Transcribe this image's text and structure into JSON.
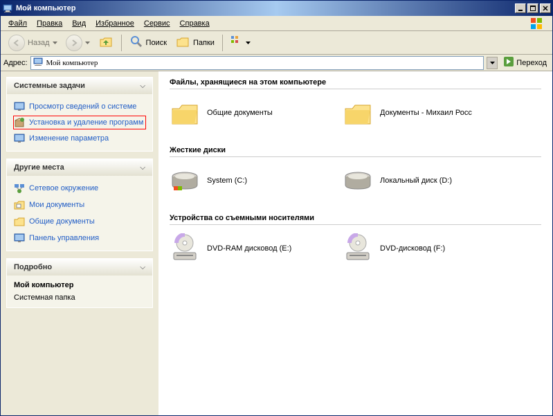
{
  "window": {
    "title": "Мой компьютер"
  },
  "menu": {
    "file": "Файл",
    "edit": "Правка",
    "view": "Вид",
    "favorites": "Избранное",
    "service": "Сервис",
    "help": "Справка"
  },
  "toolbar": {
    "back": "Назад",
    "search": "Поиск",
    "folders": "Папки"
  },
  "address": {
    "label": "Адрес:",
    "value": "Мой компьютер",
    "go": "Переход"
  },
  "panels": {
    "system": {
      "title": "Системные задачи",
      "items": [
        "Просмотр сведений о системе",
        "Установка и удаление программ",
        "Изменение параметра"
      ]
    },
    "other": {
      "title": "Другие места",
      "items": [
        "Сетевое окружение",
        "Мои документы",
        "Общие документы",
        "Панель управления"
      ]
    },
    "details": {
      "title": "Подробно",
      "heading": "Мой компьютер",
      "sub": "Системная папка"
    }
  },
  "groups": {
    "files": {
      "title": "Файлы, хранящиеся на этом компьютере",
      "items": [
        "Общие документы",
        "Документы - Михаил Росс"
      ]
    },
    "disks": {
      "title": "Жесткие диски",
      "items": [
        "System (C:)",
        "Локальный диск (D:)"
      ]
    },
    "removable": {
      "title": "Устройства со съемными носителями",
      "items": [
        "DVD-RAM дисковод (E:)",
        "DVD-дисковод (F:)"
      ]
    }
  }
}
